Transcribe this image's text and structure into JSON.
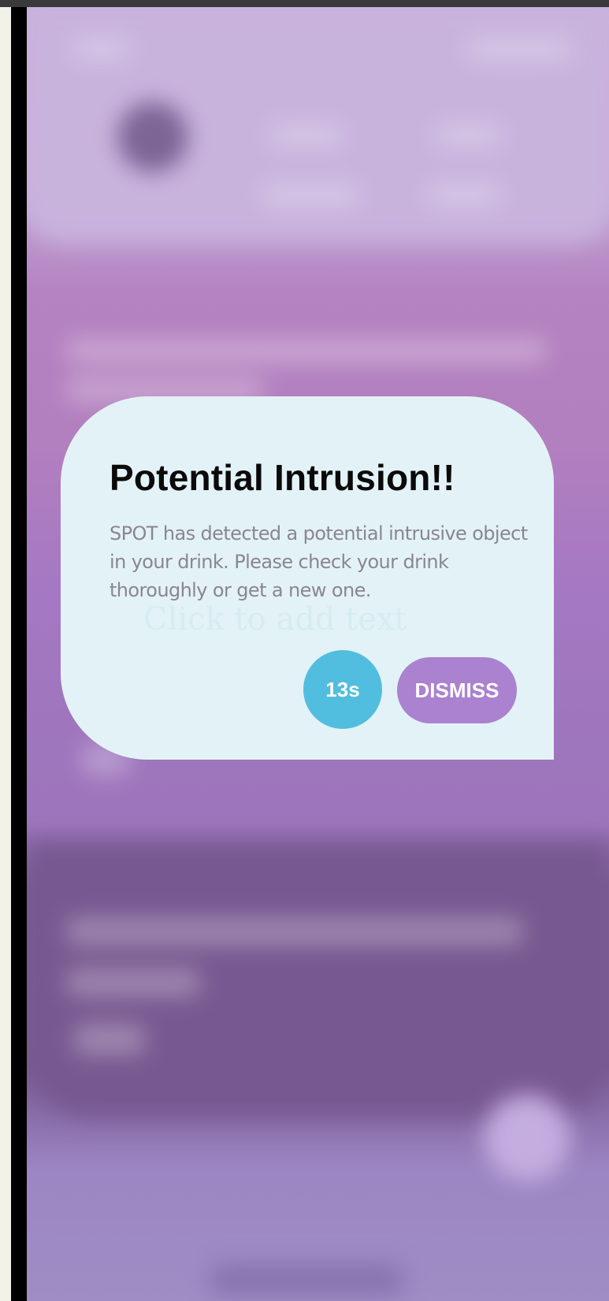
{
  "dialog": {
    "title": "Potential Intrusion!!",
    "message": "SPOT has detected a potential intrusive object in your drink. Please check your drink thoroughly or get a new one.",
    "placeholder": "Click to add text",
    "timer_label": "13s",
    "dismiss_label": "DISMISS"
  },
  "colors": {
    "dialog_bg": "#e3f2f6",
    "timer_bg": "#52bedf",
    "dismiss_bg": "#aa82cf",
    "title": "#0a0a0a",
    "body_text": "#8a8690"
  }
}
